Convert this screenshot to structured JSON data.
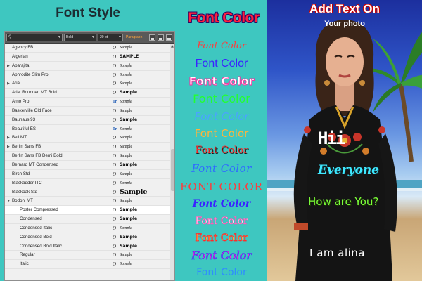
{
  "font_style_panel": {
    "title": "Font Style",
    "toolbar": {
      "font_field": "",
      "style_field": "Bold",
      "size_field": "20 pt",
      "paragraph_label": "Paragraph"
    },
    "fonts": [
      {
        "name": "Agency FB",
        "sample": "Sample",
        "type": "opentype"
      },
      {
        "name": "Algerian",
        "sample": "SAMPLE",
        "type": "opentype"
      },
      {
        "name": "Aparajita",
        "sample": "Sample",
        "type": "opentype",
        "expandable": true
      },
      {
        "name": "Aphrodite Slim Pro",
        "sample": "Sample",
        "type": "opentype"
      },
      {
        "name": "Arial",
        "sample": "Sample",
        "type": "opentype",
        "expandable": true
      },
      {
        "name": "Arial Rounded MT Bold",
        "sample": "Sample",
        "type": "opentype"
      },
      {
        "name": "Arno Pro",
        "sample": "Sample",
        "type": "truetype"
      },
      {
        "name": "Baskerville Old Face",
        "sample": "Sample",
        "type": "opentype"
      },
      {
        "name": "Bauhaus 93",
        "sample": "Sample",
        "type": "opentype"
      },
      {
        "name": "Beautiful ES",
        "sample": "Sample",
        "type": "truetype"
      },
      {
        "name": "Bell MT",
        "sample": "Sample",
        "type": "opentype",
        "expandable": true
      },
      {
        "name": "Berlin Sans FB",
        "sample": "Sample",
        "type": "opentype",
        "expandable": true
      },
      {
        "name": "Berlin Sans FB Demi Bold",
        "sample": "Sample",
        "type": "opentype"
      },
      {
        "name": "Bernard MT Condensed",
        "sample": "Sample",
        "type": "opentype"
      },
      {
        "name": "Birch Std",
        "sample": "Sample",
        "type": "opentype"
      },
      {
        "name": "Blackadder ITC",
        "sample": "Sample",
        "type": "opentype"
      },
      {
        "name": "Blackoak Std",
        "sample": "Sample",
        "type": "opentype"
      },
      {
        "name": "Bodoni MT",
        "sample": "Sample",
        "type": "opentype",
        "expandable": true,
        "expanded": true
      },
      {
        "name": "Poster Compressed",
        "sample": "Sample",
        "type": "opentype",
        "sub": true,
        "selected": true
      },
      {
        "name": "Condensed",
        "sample": "Sample",
        "type": "opentype",
        "sub": true
      },
      {
        "name": "Condensed Italic",
        "sample": "Sample",
        "type": "opentype",
        "sub": true
      },
      {
        "name": "Condensed Bold",
        "sample": "Sample",
        "type": "opentype",
        "sub": true
      },
      {
        "name": "Condensed Bold Italic",
        "sample": "Sample",
        "type": "opentype",
        "sub": true
      },
      {
        "name": "Regular",
        "sample": "Sample",
        "type": "opentype",
        "sub": true
      },
      {
        "name": "Italic",
        "sample": "Sample",
        "type": "opentype",
        "sub": true
      }
    ]
  },
  "font_color_column": {
    "title": "Font Color",
    "samples": [
      "Font Color",
      "Font Color",
      "Font Color",
      "Font Color",
      "Font Color",
      "Font Color",
      "Font Color",
      "Font Color",
      "FONT COLOR",
      "Font Color",
      "Font Color",
      "Font Color",
      "Font Color",
      "Font Color"
    ]
  },
  "photo_panel": {
    "title": "Add Text On",
    "subtitle": "Your photo",
    "overlays": {
      "hii": "Hii",
      "everyone": "Everyone",
      "how_are_you": "How are You?",
      "name": "I am alina"
    }
  },
  "colors": {
    "background": "#3ec7c0",
    "title_red": "#ff1e3c",
    "panel_bg": "#f0f0f0",
    "toolbar_bg": "#5a5a5a",
    "paragraph_orange": "#ffa63d"
  }
}
